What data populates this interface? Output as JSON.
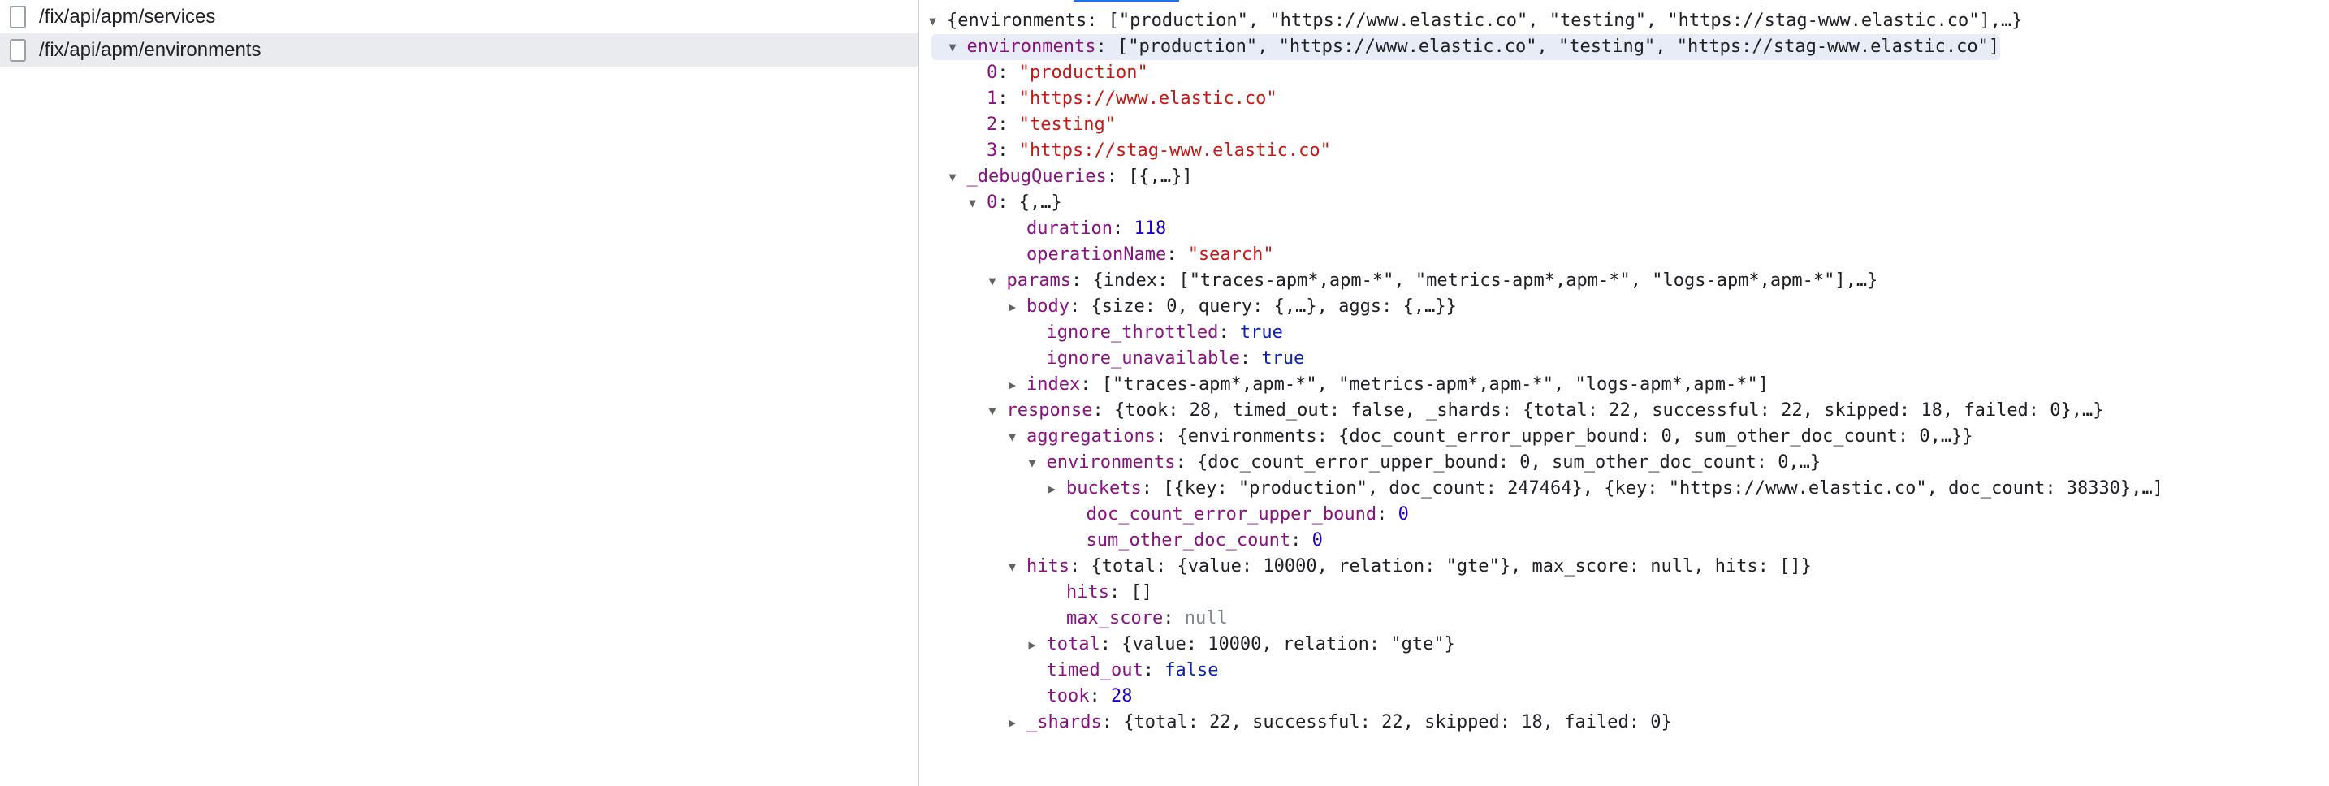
{
  "requests": [
    {
      "path": "/fix/api/apm/services",
      "selected": false
    },
    {
      "path": "/fix/api/apm/environments",
      "selected": true
    }
  ],
  "tree": [
    {
      "d": 0,
      "t": "down",
      "p": "{environments: [\"production\", \"https://www.elastic.co\", \"testing\", \"https://stag-www.elastic.co\"],…}",
      "hl": false
    },
    {
      "d": 1,
      "t": "down",
      "k": "environments",
      "p": "[\"production\", \"https://www.elastic.co\", \"testing\", \"https://stag-www.elastic.co\"]",
      "hl": true
    },
    {
      "d": 2,
      "k": "0",
      "v": "\"production\"",
      "vt": "s"
    },
    {
      "d": 2,
      "k": "1",
      "v": "\"https://www.elastic.co\"",
      "vt": "s"
    },
    {
      "d": 2,
      "k": "2",
      "v": "\"testing\"",
      "vt": "s"
    },
    {
      "d": 2,
      "k": "3",
      "v": "\"https://stag-www.elastic.co\"",
      "vt": "s"
    },
    {
      "d": 1,
      "t": "down",
      "k": "_debugQueries",
      "p": "[{,…}]"
    },
    {
      "d": 2,
      "t": "down",
      "k": "0",
      "p": "{,…}"
    },
    {
      "d": 4,
      "k": "duration",
      "v": "118",
      "vt": "n"
    },
    {
      "d": 4,
      "k": "operationName",
      "v": "\"search\"",
      "vt": "s"
    },
    {
      "d": 3,
      "t": "down",
      "k": "params",
      "p": "{index: [\"traces-apm*,apm-*\", \"metrics-apm*,apm-*\", \"logs-apm*,apm-*\"],…}"
    },
    {
      "d": 4,
      "t": "right",
      "k": "body",
      "p": "{size: 0, query: {,…}, aggs: {,…}}"
    },
    {
      "d": 5,
      "k": "ignore_throttled",
      "v": "true",
      "vt": "b"
    },
    {
      "d": 5,
      "k": "ignore_unavailable",
      "v": "true",
      "vt": "b"
    },
    {
      "d": 4,
      "t": "right",
      "k": "index",
      "p": "[\"traces-apm*,apm-*\", \"metrics-apm*,apm-*\", \"logs-apm*,apm-*\"]"
    },
    {
      "d": 3,
      "t": "down",
      "k": "response",
      "p": "{took: 28, timed_out: false, _shards: {total: 22, successful: 22, skipped: 18, failed: 0},…}"
    },
    {
      "d": 4,
      "t": "down",
      "k": "aggregations",
      "p": "{environments: {doc_count_error_upper_bound: 0, sum_other_doc_count: 0,…}}"
    },
    {
      "d": 5,
      "t": "down",
      "k": "environments",
      "p": "{doc_count_error_upper_bound: 0, sum_other_doc_count: 0,…}"
    },
    {
      "d": 6,
      "t": "right",
      "k": "buckets",
      "p": "[{key: \"production\", doc_count: 247464}, {key: \"https://www.elastic.co\", doc_count: 38330},…]"
    },
    {
      "d": 7,
      "k": "doc_count_error_upper_bound",
      "v": "0",
      "vt": "n"
    },
    {
      "d": 7,
      "k": "sum_other_doc_count",
      "v": "0",
      "vt": "n"
    },
    {
      "d": 4,
      "t": "down",
      "k": "hits",
      "p": "{total: {value: 10000, relation: \"gte\"}, max_score: null, hits: []}"
    },
    {
      "d": 6,
      "k": "hits",
      "v": "[]",
      "vt": "p"
    },
    {
      "d": 6,
      "k": "max_score",
      "v": "null",
      "vt": "nl"
    },
    {
      "d": 5,
      "t": "right",
      "k": "total",
      "p": "{value: 10000, relation: \"gte\"}"
    },
    {
      "d": 5,
      "k": "timed_out",
      "v": "false",
      "vt": "b"
    },
    {
      "d": 5,
      "k": "took",
      "v": "28",
      "vt": "n"
    },
    {
      "d": 4,
      "t": "right",
      "k": "_shards",
      "p": "{total: 22, successful: 22, skipped: 18, failed: 0}"
    }
  ]
}
